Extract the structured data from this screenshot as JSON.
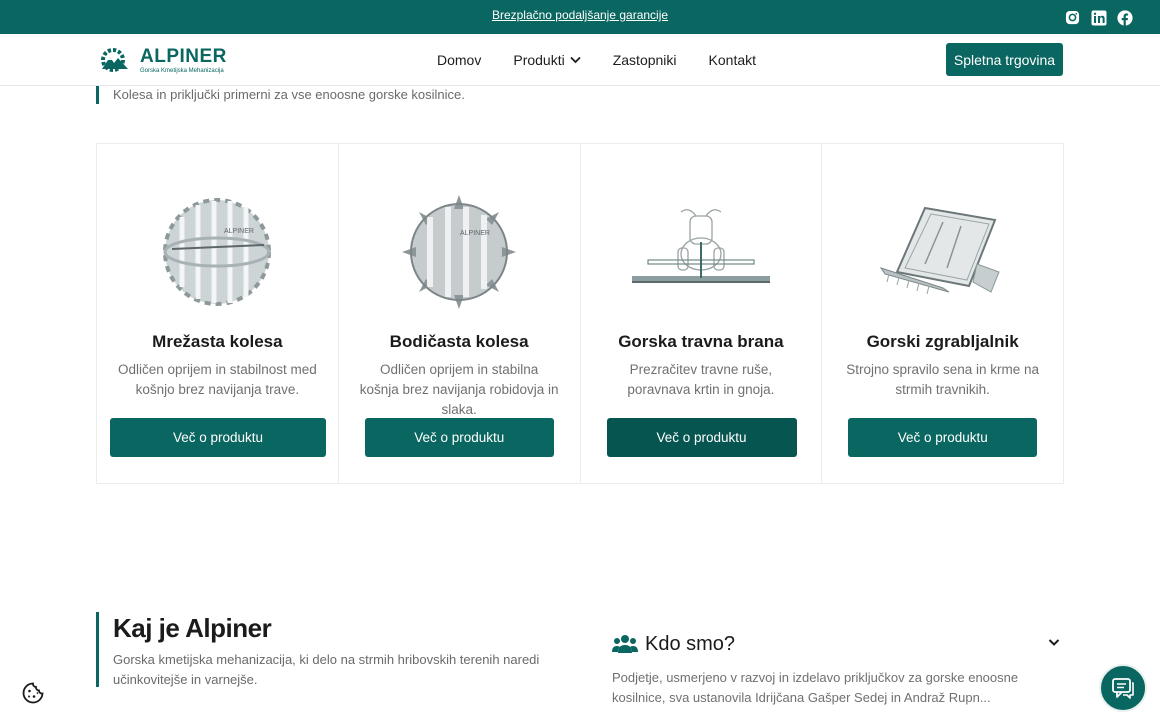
{
  "topbar": {
    "link_text": "Brezplačno podaljšanje garancije",
    "social": [
      "instagram-icon",
      "linkedin-icon",
      "facebook-icon"
    ]
  },
  "nav": {
    "logo_name": "ALPINER",
    "logo_sub": "Gorska Kmetijska Mehanizacija",
    "menu": [
      "Domov",
      "Produkti",
      "Zastopniki",
      "Kontakt"
    ],
    "shop_button": "Spletna trgovina"
  },
  "intro_text": "Kolesa in priključki primerni za vse enoosne gorske kosilnice.",
  "products": [
    {
      "title": "Mrežasta kolesa",
      "desc": "Odličen oprijem in stabilnost med košnjo brez navijanja trave.",
      "button": "Več o produktu",
      "image": "mesh-wheel-image"
    },
    {
      "title": "Bodičasta kolesa",
      "desc": "Odličen oprijem in stabilna košnja brez navijanja robidovja in slaka.",
      "button": "Več o produktu",
      "image": "spike-wheel-image"
    },
    {
      "title": "Gorska travna brana",
      "desc": "Prezračitev travne ruše, poravnava krtin in gnoja.",
      "button": "Več o produktu",
      "image": "grass-harrow-image"
    },
    {
      "title": "Gorski zgrabljalnik",
      "desc": "Strojno spravilo sena in krme na strmih travnikih.",
      "button": "Več o produktu",
      "image": "hay-rake-image"
    }
  ],
  "about": {
    "title": "Kaj je Alpiner",
    "text": "Gorska kmetijska mehanizacija, ki delo na strmih hribovskih terenih naredi učinkovitejše in varnejše."
  },
  "who": {
    "title": "Kdo smo?",
    "text": "Podjetje, usmerjeno v razvoj in izdelavo priključkov za gorske enoosne kosilnice, sva ustanovila Idrijčana Gašper Sedej in Andraž Rupn..."
  },
  "colors": {
    "brand": "#0a6660",
    "brand_dark": "#075550",
    "muted_text": "#707070"
  }
}
